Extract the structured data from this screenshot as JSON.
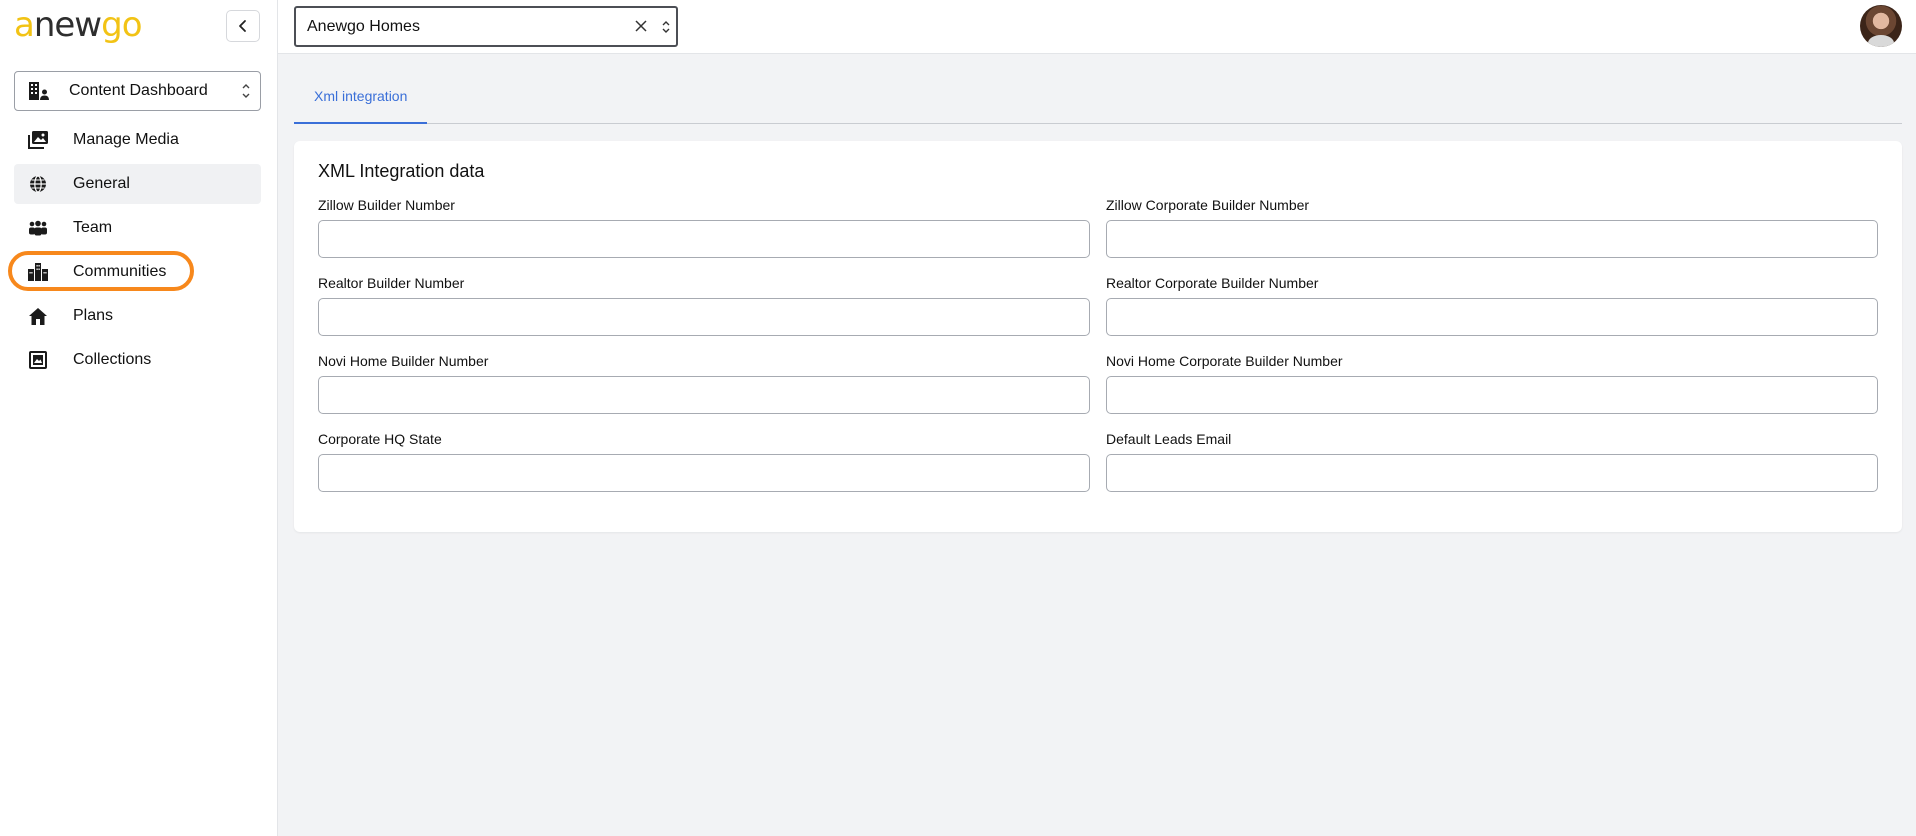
{
  "sidebar": {
    "logo_prefix": "a",
    "logo_mid": "new",
    "logo_suffix": "go",
    "dashboard_select": "Content Dashboard",
    "items": [
      {
        "label": "Manage Media",
        "icon": "media-icon"
      },
      {
        "label": "General",
        "icon": "globe-icon",
        "active": true
      },
      {
        "label": "Team",
        "icon": "team-icon"
      },
      {
        "label": "Communities",
        "icon": "communities-icon",
        "highlighted": true
      },
      {
        "label": "Plans",
        "icon": "home-icon"
      },
      {
        "label": "Collections",
        "icon": "collections-icon"
      }
    ]
  },
  "topbar": {
    "company": "Anewgo Homes"
  },
  "tabs": [
    {
      "label": "Xml integration",
      "active": true
    }
  ],
  "form": {
    "title": "XML Integration data",
    "fields": [
      {
        "label": "Zillow Builder Number",
        "value": ""
      },
      {
        "label": "Zillow Corporate Builder Number",
        "value": ""
      },
      {
        "label": "Realtor Builder Number",
        "value": ""
      },
      {
        "label": "Realtor Corporate Builder Number",
        "value": ""
      },
      {
        "label": "Novi Home Builder Number",
        "value": ""
      },
      {
        "label": "Novi Home Corporate Builder Number",
        "value": ""
      },
      {
        "label": "Corporate HQ State",
        "value": ""
      },
      {
        "label": "Default Leads Email",
        "value": ""
      }
    ]
  },
  "colors": {
    "accent": "#3a6fd8",
    "highlight": "#f7881c",
    "logo_yellow": "#f2c315"
  }
}
